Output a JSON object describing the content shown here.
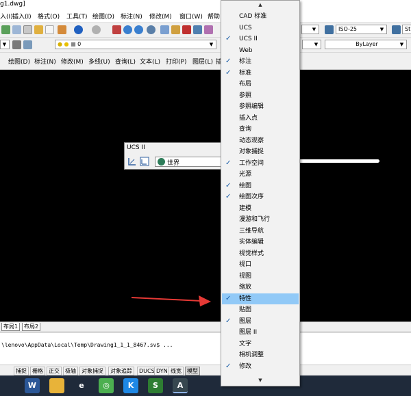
{
  "window": {
    "title": "g1.dwg]"
  },
  "menubar": [
    {
      "label": "入(I)"
    },
    {
      "label": "插入(I)"
    },
    {
      "label": "格式(O)"
    },
    {
      "label": "工具(T)"
    },
    {
      "label": "绘图(D)"
    },
    {
      "label": "标注(N)"
    },
    {
      "label": "修改(M)"
    },
    {
      "label": "窗口(W)"
    },
    {
      "label": "帮助"
    }
  ],
  "toolbar_row1": {
    "dimstyle": "ISO-25",
    "style_partial": "St"
  },
  "toolbar_row2": {
    "layer": "0",
    "linetype": "ByLayer"
  },
  "submenu_row": [
    {
      "label": "绘图(D)"
    },
    {
      "label": "标注(N)"
    },
    {
      "label": "修改(M)"
    },
    {
      "label": "多线(U)"
    },
    {
      "label": "查询(L)"
    },
    {
      "label": "文本(L)"
    },
    {
      "label": "打印(P)"
    },
    {
      "label": "图层(L)"
    },
    {
      "label": "插"
    }
  ],
  "ucs_toolbar": {
    "title": "UCS II",
    "combo_value": "世界"
  },
  "layout_tabs": [
    {
      "label": "布局1"
    },
    {
      "label": "布局2"
    }
  ],
  "command_line": {
    "text": "\\lenovo\\AppData\\Local\\Temp\\Drawing1_1_1_8467.sv$ ..."
  },
  "status_buttons": [
    {
      "label": "捕捉",
      "on": false
    },
    {
      "label": "栅格",
      "on": false
    },
    {
      "label": "正交",
      "on": false
    },
    {
      "label": "极轴",
      "on": false
    },
    {
      "label": "对象捕捉",
      "on": false
    },
    {
      "label": "对象追踪",
      "on": false
    },
    {
      "label": "DUCS",
      "on": false
    },
    {
      "label": "DYN",
      "on": false
    },
    {
      "label": "线宽",
      "on": false
    },
    {
      "label": "模型",
      "on": true
    }
  ],
  "context_menu": {
    "scroll_up": "▲",
    "scroll_down": "▼",
    "items": [
      {
        "label": "CAD 标准",
        "checked": false
      },
      {
        "label": "UCS",
        "checked": false
      },
      {
        "label": "UCS II",
        "checked": true
      },
      {
        "label": "Web",
        "checked": false
      },
      {
        "label": "标注",
        "checked": true
      },
      {
        "label": "标准",
        "checked": true
      },
      {
        "label": "布局",
        "checked": false
      },
      {
        "label": "参照",
        "checked": false
      },
      {
        "label": "参照编辑",
        "checked": false
      },
      {
        "label": "插入点",
        "checked": false
      },
      {
        "label": "查询",
        "checked": false
      },
      {
        "label": "动态观察",
        "checked": false
      },
      {
        "label": "对象捕捉",
        "checked": false
      },
      {
        "label": "工作空间",
        "checked": true
      },
      {
        "label": "光源",
        "checked": false
      },
      {
        "label": "绘图",
        "checked": true
      },
      {
        "label": "绘图次序",
        "checked": true
      },
      {
        "label": "建模",
        "checked": false
      },
      {
        "label": "漫游和飞行",
        "checked": false
      },
      {
        "label": "三维导航",
        "checked": false
      },
      {
        "label": "实体编辑",
        "checked": false
      },
      {
        "label": "视觉样式",
        "checked": false
      },
      {
        "label": "视口",
        "checked": false
      },
      {
        "label": "视图",
        "checked": false
      },
      {
        "label": "缩放",
        "checked": false
      },
      {
        "label": "特性",
        "checked": true,
        "highlighted": true
      },
      {
        "label": "贴图",
        "checked": false
      },
      {
        "label": "图层",
        "checked": true
      },
      {
        "label": "图层 II",
        "checked": false
      },
      {
        "label": "文字",
        "checked": false
      },
      {
        "label": "相机调整",
        "checked": false
      },
      {
        "label": "修改",
        "checked": true
      }
    ]
  },
  "taskbar": {
    "apps": [
      {
        "icon": "pinwheel-icon",
        "text": "",
        "color": "#1f2a3a"
      },
      {
        "icon": "word-icon",
        "text": "W",
        "color": "#2b5797"
      },
      {
        "icon": "folder-icon",
        "text": "",
        "color": "#e8b339"
      },
      {
        "icon": "edge-icon",
        "text": "e",
        "color": "#1f2a3a"
      },
      {
        "icon": "green-circle-icon",
        "text": "◎",
        "color": "#4caf50"
      },
      {
        "icon": "k-icon",
        "text": "K",
        "color": "#1e88e5"
      },
      {
        "icon": "s-icon",
        "text": "S",
        "color": "#2e7d32"
      },
      {
        "icon": "autocad-icon",
        "text": "A",
        "color": "#37474f"
      }
    ]
  },
  "check_glyph": "✓",
  "colors": {
    "highlight": "#91c9f7",
    "canvas": "#000000",
    "annotation_arrow": "#e53935"
  }
}
